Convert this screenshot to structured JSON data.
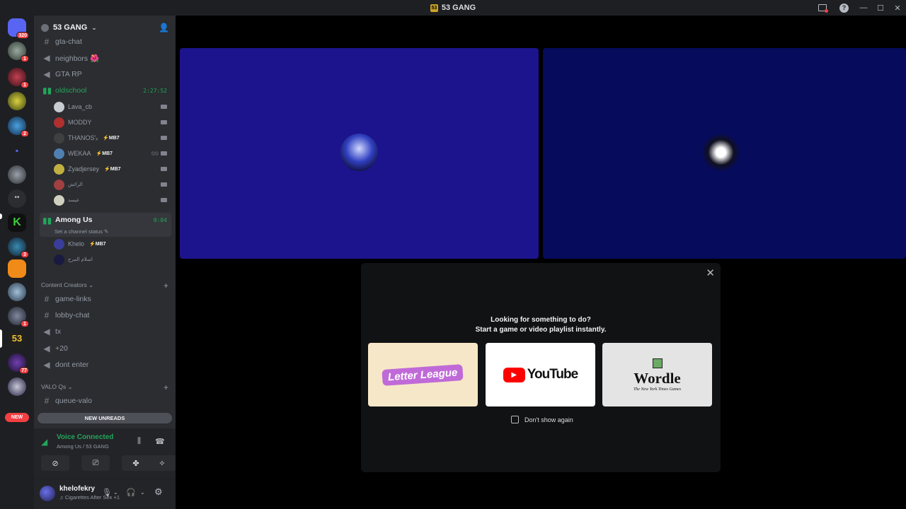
{
  "window": {
    "title": "53 GANG"
  },
  "server": {
    "name": "53 GANG"
  },
  "guild_badges": [
    "320",
    "1",
    "1",
    "2",
    "3",
    "1",
    "77"
  ],
  "guild_new": "NEW",
  "channels_top": [
    {
      "label": "gta-chat",
      "icon": "#"
    },
    {
      "label": "neighbors 🌺",
      "icon": "🔊"
    },
    {
      "label": "GTA RP",
      "icon": "🔊"
    }
  ],
  "voice_oldschool": {
    "label": "oldschool",
    "timer": "2:27:52"
  },
  "oldschool_users": [
    {
      "name": "Lava_cb",
      "tag": ""
    },
    {
      "name": "MODDY",
      "tag": ""
    },
    {
      "name": "THANOS'ₓ",
      "tag": "⚡MB7"
    },
    {
      "name": "WEKAA",
      "tag": "⚡MB7"
    },
    {
      "name": "Zyadjersey",
      "tag": "⚡MB7"
    },
    {
      "name": "الرائش",
      "tag": ""
    },
    {
      "name": "عيسد",
      "tag": ""
    }
  ],
  "voice_among": {
    "label": "Among Us",
    "timer": "0:04",
    "status": "Set a channel status ✎"
  },
  "among_users": [
    {
      "name": "Khelo",
      "tag": "⚡MB7"
    },
    {
      "name": "اسلام المرح",
      "tag": ""
    }
  ],
  "category_content": {
    "label": "Content Creators ⌄"
  },
  "channels_content": [
    {
      "label": "game-links",
      "icon": "#"
    },
    {
      "label": "lobby-chat",
      "icon": "#"
    },
    {
      "label": "tx",
      "icon": "🔊"
    },
    {
      "label": "+20",
      "icon": "🔊"
    },
    {
      "label": "dont enter",
      "icon": "🔊"
    }
  ],
  "category_valo": {
    "label": "VALO Qs ⌄"
  },
  "channels_valo": [
    {
      "label": "queue-valo",
      "icon": "#"
    }
  ],
  "new_unreads": "NEW UNREADS",
  "voice_connected": {
    "title": "Voice Connected",
    "sub": "Among Us / 53 GANG"
  },
  "user": {
    "name": "khelofekry",
    "status": "♫ Cigarettes After Sex +1"
  },
  "activity": {
    "line1": "Looking for something to do?",
    "line2": "Start a game or video playlist instantly.",
    "cards": [
      {
        "name": "Letter League"
      },
      {
        "name": "YouTube"
      },
      {
        "name": "Wordle",
        "sub": "The New York Times Games"
      }
    ],
    "checkbox_label": "Don't show again"
  },
  "colors": {
    "accent_green": "#23a55a",
    "danger": "#f23f43",
    "tile_a": "#1c148c",
    "tile_b": "#060b5c"
  }
}
